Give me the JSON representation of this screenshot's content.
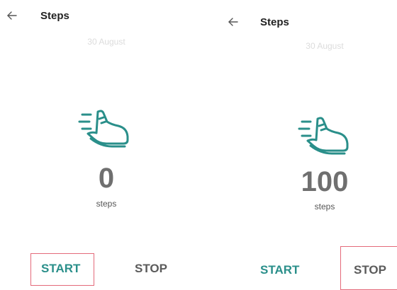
{
  "screens": [
    {
      "title": "Steps",
      "date": "30 August",
      "count": "0",
      "unit": "steps",
      "start_label": "START",
      "stop_label": "STOP",
      "highlighted_button": "START"
    },
    {
      "title": "Steps",
      "date": "30 August",
      "count": "100",
      "unit": "steps",
      "start_label": "START",
      "stop_label": "STOP",
      "highlighted_button": "STOP"
    }
  ],
  "icons": {
    "back": "arrow-left-icon",
    "activity": "running-shoe-icon"
  },
  "colors": {
    "accent": "#2a8f8a",
    "highlight": "#e46a7a",
    "count_text": "#6f6f6f",
    "date_text": "#dcdcdc"
  }
}
